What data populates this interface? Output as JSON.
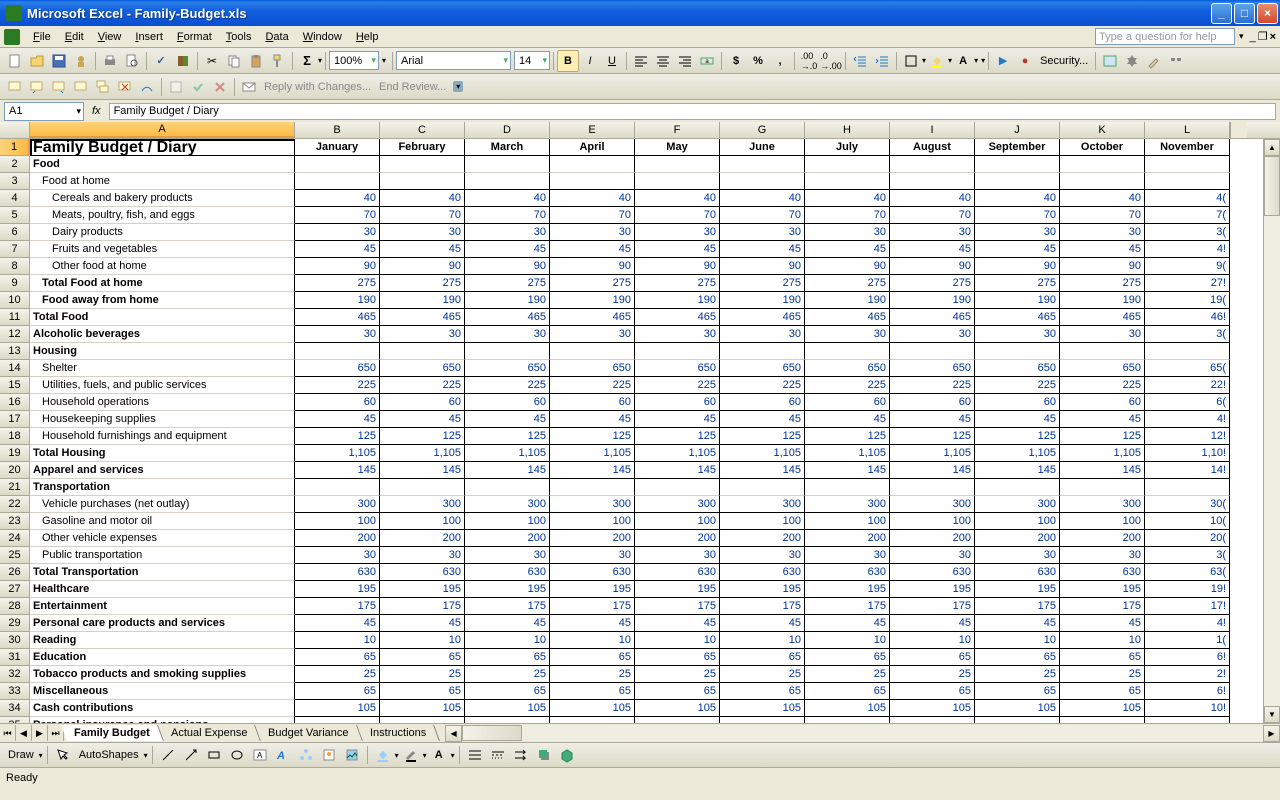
{
  "title": "Microsoft Excel - Family-Budget.xls",
  "menus": [
    "File",
    "Edit",
    "View",
    "Insert",
    "Format",
    "Tools",
    "Data",
    "Window",
    "Help"
  ],
  "helpPlaceholder": "Type a question for help",
  "zoom": "100%",
  "font": "Arial",
  "fontsize": "14",
  "namebox": "A1",
  "formula": "Family Budget / Diary",
  "reviewing": {
    "reply": "Reply with Changes...",
    "end": "End Review..."
  },
  "security": "Security...",
  "columns": [
    "A",
    "B",
    "C",
    "D",
    "E",
    "F",
    "G",
    "H",
    "I",
    "J",
    "K",
    "L"
  ],
  "months": [
    "January",
    "February",
    "March",
    "April",
    "May",
    "June",
    "July",
    "August",
    "September",
    "October",
    "November"
  ],
  "rows": [
    {
      "n": 1,
      "a": "Family Budget / Diary",
      "title": true,
      "monthsHeader": true
    },
    {
      "n": 2,
      "a": "Food",
      "boldCat": true
    },
    {
      "n": 3,
      "a": "Food at home",
      "ind": 1
    },
    {
      "n": 4,
      "a": "Cereals and bakery products",
      "ind": 2,
      "vals": [
        40,
        40,
        40,
        40,
        40,
        40,
        40,
        40,
        40,
        40,
        "4("
      ]
    },
    {
      "n": 5,
      "a": "Meats, poultry, fish, and eggs",
      "ind": 2,
      "vals": [
        70,
        70,
        70,
        70,
        70,
        70,
        70,
        70,
        70,
        70,
        "7("
      ]
    },
    {
      "n": 6,
      "a": "Dairy products",
      "ind": 2,
      "vals": [
        30,
        30,
        30,
        30,
        30,
        30,
        30,
        30,
        30,
        30,
        "3("
      ]
    },
    {
      "n": 7,
      "a": "Fruits and vegetables",
      "ind": 2,
      "vals": [
        45,
        45,
        45,
        45,
        45,
        45,
        45,
        45,
        45,
        45,
        "4!"
      ]
    },
    {
      "n": 8,
      "a": "Other food at home",
      "ind": 2,
      "vals": [
        90,
        90,
        90,
        90,
        90,
        90,
        90,
        90,
        90,
        90,
        "9("
      ]
    },
    {
      "n": 9,
      "a": "Total Food at home",
      "bold": true,
      "ind": 1,
      "vals": [
        275,
        275,
        275,
        275,
        275,
        275,
        275,
        275,
        275,
        275,
        "27!"
      ]
    },
    {
      "n": 10,
      "a": "Food away from home",
      "bold": true,
      "ind": 1,
      "vals": [
        190,
        190,
        190,
        190,
        190,
        190,
        190,
        190,
        190,
        190,
        "19("
      ]
    },
    {
      "n": 11,
      "a": "Total Food",
      "bold": true,
      "vals": [
        465,
        465,
        465,
        465,
        465,
        465,
        465,
        465,
        465,
        465,
        "46!"
      ]
    },
    {
      "n": 12,
      "a": "Alcoholic beverages",
      "bold": true,
      "vals": [
        30,
        30,
        30,
        30,
        30,
        30,
        30,
        30,
        30,
        30,
        "3("
      ]
    },
    {
      "n": 13,
      "a": "Housing",
      "boldCat": true
    },
    {
      "n": 14,
      "a": "Shelter",
      "ind": 1,
      "vals": [
        650,
        650,
        650,
        650,
        650,
        650,
        650,
        650,
        650,
        650,
        "65("
      ]
    },
    {
      "n": 15,
      "a": "Utilities, fuels, and public services",
      "ind": 1,
      "vals": [
        225,
        225,
        225,
        225,
        225,
        225,
        225,
        225,
        225,
        225,
        "22!"
      ]
    },
    {
      "n": 16,
      "a": "Household operations",
      "ind": 1,
      "vals": [
        60,
        60,
        60,
        60,
        60,
        60,
        60,
        60,
        60,
        60,
        "6("
      ]
    },
    {
      "n": 17,
      "a": "Housekeeping supplies",
      "ind": 1,
      "vals": [
        45,
        45,
        45,
        45,
        45,
        45,
        45,
        45,
        45,
        45,
        "4!"
      ]
    },
    {
      "n": 18,
      "a": "Household furnishings and equipment",
      "ind": 1,
      "vals": [
        125,
        125,
        125,
        125,
        125,
        125,
        125,
        125,
        125,
        125,
        "12!"
      ]
    },
    {
      "n": 19,
      "a": "Total Housing",
      "bold": true,
      "vals": [
        "1,105",
        "1,105",
        "1,105",
        "1,105",
        "1,105",
        "1,105",
        "1,105",
        "1,105",
        "1,105",
        "1,105",
        "1,10!"
      ]
    },
    {
      "n": 20,
      "a": "Apparel and services",
      "bold": true,
      "vals": [
        145,
        145,
        145,
        145,
        145,
        145,
        145,
        145,
        145,
        145,
        "14!"
      ]
    },
    {
      "n": 21,
      "a": "Transportation",
      "boldCat": true
    },
    {
      "n": 22,
      "a": "Vehicle purchases (net outlay)",
      "ind": 1,
      "vals": [
        300,
        300,
        300,
        300,
        300,
        300,
        300,
        300,
        300,
        300,
        "30("
      ]
    },
    {
      "n": 23,
      "a": "Gasoline and motor oil",
      "ind": 1,
      "vals": [
        100,
        100,
        100,
        100,
        100,
        100,
        100,
        100,
        100,
        100,
        "10("
      ]
    },
    {
      "n": 24,
      "a": "Other vehicle expenses",
      "ind": 1,
      "vals": [
        200,
        200,
        200,
        200,
        200,
        200,
        200,
        200,
        200,
        200,
        "20("
      ]
    },
    {
      "n": 25,
      "a": "Public transportation",
      "ind": 1,
      "vals": [
        30,
        30,
        30,
        30,
        30,
        30,
        30,
        30,
        30,
        30,
        "3("
      ]
    },
    {
      "n": 26,
      "a": "Total Transportation",
      "bold": true,
      "vals": [
        630,
        630,
        630,
        630,
        630,
        630,
        630,
        630,
        630,
        630,
        "63("
      ]
    },
    {
      "n": 27,
      "a": "Healthcare",
      "bold": true,
      "vals": [
        195,
        195,
        195,
        195,
        195,
        195,
        195,
        195,
        195,
        195,
        "19!"
      ]
    },
    {
      "n": 28,
      "a": "Entertainment",
      "bold": true,
      "vals": [
        175,
        175,
        175,
        175,
        175,
        175,
        175,
        175,
        175,
        175,
        "17!"
      ]
    },
    {
      "n": 29,
      "a": "Personal care products and services",
      "bold": true,
      "vals": [
        45,
        45,
        45,
        45,
        45,
        45,
        45,
        45,
        45,
        45,
        "4!"
      ]
    },
    {
      "n": 30,
      "a": "Reading",
      "bold": true,
      "vals": [
        10,
        10,
        10,
        10,
        10,
        10,
        10,
        10,
        10,
        10,
        "1("
      ]
    },
    {
      "n": 31,
      "a": "Education",
      "bold": true,
      "vals": [
        65,
        65,
        65,
        65,
        65,
        65,
        65,
        65,
        65,
        65,
        "6!"
      ]
    },
    {
      "n": 32,
      "a": "Tobacco products and smoking supplies",
      "bold": true,
      "vals": [
        25,
        25,
        25,
        25,
        25,
        25,
        25,
        25,
        25,
        25,
        "2!"
      ]
    },
    {
      "n": 33,
      "a": "Miscellaneous",
      "bold": true,
      "vals": [
        65,
        65,
        65,
        65,
        65,
        65,
        65,
        65,
        65,
        65,
        "6!"
      ]
    },
    {
      "n": 34,
      "a": "Cash contributions",
      "bold": true,
      "vals": [
        105,
        105,
        105,
        105,
        105,
        105,
        105,
        105,
        105,
        105,
        "10!"
      ]
    },
    {
      "n": 35,
      "a": "Personal insurance and pensions",
      "bold": true
    }
  ],
  "sheets": [
    "Family Budget",
    "Actual Expense",
    "Budget Variance",
    "Instructions"
  ],
  "activeSheet": 0,
  "draw": "Draw",
  "autoshapes": "AutoShapes",
  "status": "Ready"
}
